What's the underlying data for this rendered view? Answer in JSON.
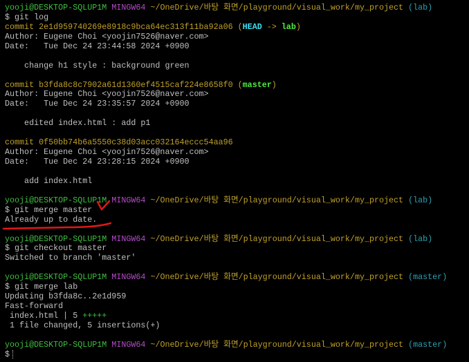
{
  "prompt": {
    "user_host": "yooji@DESKTOP-SQLUP1M",
    "system": "MINGW64",
    "path": "~/OneDrive/바탕 화면/playground/visual_work/my_project"
  },
  "lines": [
    {
      "type": "prompt",
      "branch": "(lab)"
    },
    {
      "type": "cmd",
      "text": "$ git log"
    },
    {
      "type": "commit",
      "text": "commit 2e1d959740269e8918c9bca64ec313f11ba92a06 ",
      "refs": [
        {
          "t": "(",
          "c": "yellow"
        },
        {
          "t": "HEAD",
          "c": "bcyan"
        },
        {
          "t": " -> ",
          "c": "yellow"
        },
        {
          "t": "lab",
          "c": "bgreen"
        },
        {
          "t": ")",
          "c": "yellow"
        }
      ]
    },
    {
      "type": "text",
      "text": "Author: Eugene Choi <yoojin7526@naver.com>"
    },
    {
      "type": "text",
      "text": "Date:   Tue Dec 24 23:44:58 2024 +0900"
    },
    {
      "type": "text",
      "text": ""
    },
    {
      "type": "text",
      "text": "    change h1 style : background green"
    },
    {
      "type": "text",
      "text": ""
    },
    {
      "type": "commit",
      "text": "commit b3fda8c8c7902a61d1360ef4515caf224e8658f0 ",
      "refs": [
        {
          "t": "(",
          "c": "yellow"
        },
        {
          "t": "master",
          "c": "bgreen"
        },
        {
          "t": ")",
          "c": "yellow"
        }
      ]
    },
    {
      "type": "text",
      "text": "Author: Eugene Choi <yoojin7526@naver.com>"
    },
    {
      "type": "text",
      "text": "Date:   Tue Dec 24 23:35:57 2024 +0900"
    },
    {
      "type": "text",
      "text": ""
    },
    {
      "type": "text",
      "text": "    edited index.html : add p1"
    },
    {
      "type": "text",
      "text": ""
    },
    {
      "type": "commit",
      "text": "commit 0f50bb74b6a5550c38d03acc032164eccc54aa96",
      "refs": []
    },
    {
      "type": "text",
      "text": "Author: Eugene Choi <yoojin7526@naver.com>"
    },
    {
      "type": "text",
      "text": "Date:   Tue Dec 24 23:28:15 2024 +0900"
    },
    {
      "type": "text",
      "text": ""
    },
    {
      "type": "text",
      "text": "    add index.html"
    },
    {
      "type": "text",
      "text": ""
    },
    {
      "type": "prompt",
      "branch": "(lab)"
    },
    {
      "type": "cmd",
      "text": "$ git merge master"
    },
    {
      "type": "text",
      "text": "Already up to date."
    },
    {
      "type": "text",
      "text": ""
    },
    {
      "type": "prompt",
      "branch": "(lab)"
    },
    {
      "type": "cmd",
      "text": "$ git checkout master"
    },
    {
      "type": "text",
      "text": "Switched to branch 'master'"
    },
    {
      "type": "text",
      "text": ""
    },
    {
      "type": "prompt",
      "branch": "(master)"
    },
    {
      "type": "cmd",
      "text": "$ git merge lab"
    },
    {
      "type": "text",
      "text": "Updating b3fda8c..2e1d959"
    },
    {
      "type": "text",
      "text": "Fast-forward"
    },
    {
      "type": "stat",
      "text": " index.html | 5 ",
      "plus": "+++++"
    },
    {
      "type": "text",
      "text": " 1 file changed, 5 insertions(+)"
    },
    {
      "type": "text",
      "text": ""
    },
    {
      "type": "prompt",
      "branch": "(master)"
    },
    {
      "type": "input",
      "text": "$"
    }
  ],
  "annotation_color": "#e01818"
}
